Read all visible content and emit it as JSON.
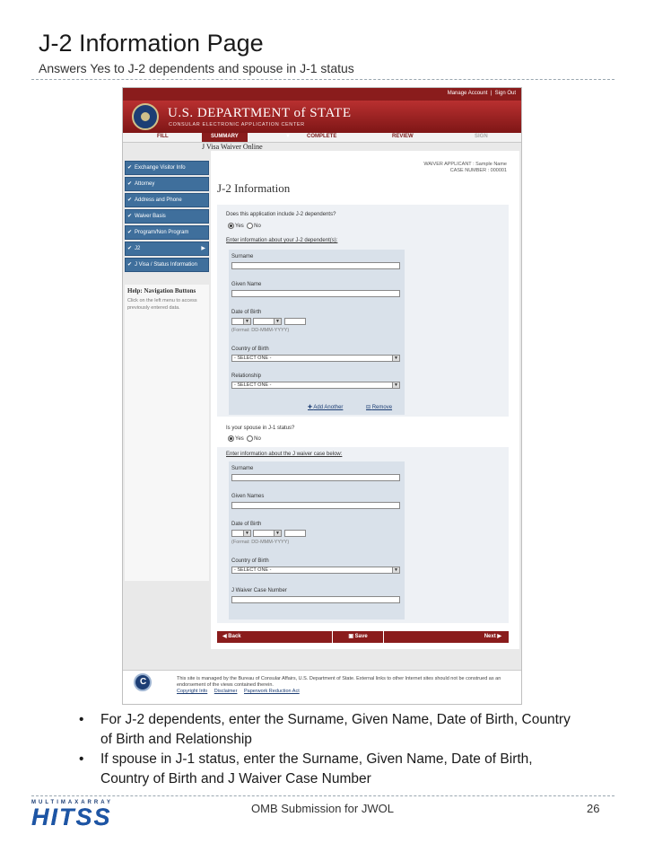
{
  "slide": {
    "title": "J-2 Information Page",
    "subtitle": "Answers Yes to J-2 dependents and spouse in J-1 status",
    "bullets": [
      "For J-2 dependents,  enter the Surname, Given Name, Date of Birth, Country of Birth and Relationship",
      "If spouse in J-1 status, enter the Surname, Given Name, Date of Birth, Country of Birth and J Waiver Case Number"
    ],
    "footer_center": "OMB Submission for JWOL",
    "page_number": "26",
    "logo_top": "MULTIMAXARRAY",
    "logo_text": "HITSS"
  },
  "screen": {
    "topbar": {
      "manage_account": "Manage Account",
      "sign_out": "Sign Out"
    },
    "banner": {
      "department": "U.S. DEPARTMENT of STATE",
      "subtitle": "CONSULAR ELECTRONIC APPLICATION CENTER"
    },
    "nav": {
      "fill": "FILL",
      "summary": "SUMMARY",
      "complete": "COMPLETE",
      "review": "REVIEW",
      "sign": "SIGN"
    },
    "app_name": "J Visa Waiver Online",
    "applicant": {
      "line1": "WAIVER APPLICANT : Sample Name",
      "line2": "CASE NUMBER : 000001"
    },
    "page_heading": "J-2 Information",
    "sidebar": [
      {
        "label": "Exchange Visitor Info",
        "arrow": false
      },
      {
        "label": "Attorney",
        "arrow": false
      },
      {
        "label": "Address and Phone",
        "arrow": false
      },
      {
        "label": "Waiver Basis",
        "arrow": false
      },
      {
        "label": "Program/Non Program",
        "arrow": false
      },
      {
        "label": "J2",
        "arrow": true
      },
      {
        "label": "J Visa / Status Information",
        "arrow": false
      }
    ],
    "help": {
      "heading": "Help: Navigation Buttons",
      "text": "Click on the left menu to access previously entered data."
    },
    "dependents": {
      "question": "Does this application include J-2 dependents?",
      "yes": "Yes",
      "no": "No",
      "prompt": "Enter information about your J-2 dependent(s):",
      "surname": "Surname",
      "given_name": "Given Name",
      "dob": "Date of Birth",
      "dob_format": "(Format: DD-MMM-YYYY)",
      "country": "Country of Birth",
      "country_value": "- SELECT ONE -",
      "relationship": "Relationship",
      "relationship_value": "- SELECT ONE -",
      "add_another": "Add Another",
      "remove": "Remove"
    },
    "spouse": {
      "question": "Is your spouse in J-1 status?",
      "yes": "Yes",
      "no": "No",
      "prompt": "Enter information about the J waiver case below:",
      "surname": "Surname",
      "given_names": "Given Names",
      "dob": "Date of Birth",
      "dob_format": "(Format: DD-MMM-YYYY)",
      "country": "Country of Birth",
      "country_value": "- SELECT ONE -",
      "case_number": "J Waiver Case Number"
    },
    "buttons": {
      "back": "Back",
      "save": "Save",
      "next": "Next"
    },
    "footer": {
      "text": "This site is managed by the Bureau of Consular Affairs, U.S. Department of State. External links to other Internet sites should not be construed as an endorsement of the views contained therein.",
      "copyright": "Copyright Info",
      "disclaimer": "Disclaimer",
      "paperwork": "Paperwork Reduction Act"
    }
  }
}
